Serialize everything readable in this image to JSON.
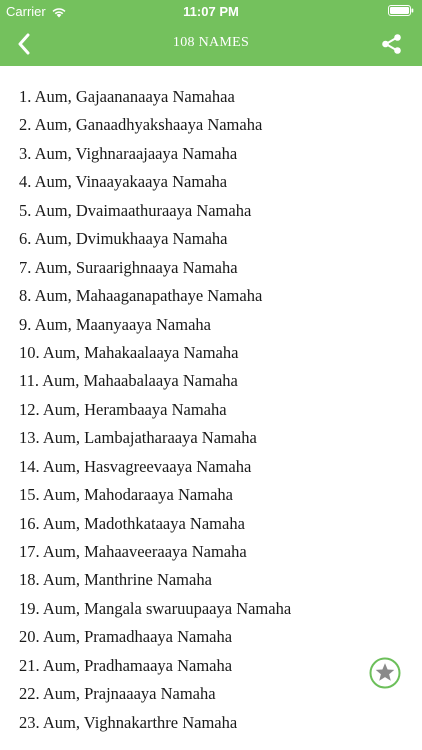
{
  "status_bar": {
    "carrier": "Carrier",
    "time": "11:07 PM",
    "icons": [
      "wifi-icon",
      "battery-icon"
    ]
  },
  "nav": {
    "title": "108 NAMES",
    "back_icon": "chevron-left-icon",
    "share_icon": "share-icon"
  },
  "names": [
    "1. Aum, Gajaananaaya Namahaa",
    "2. Aum, Ganaadhyakshaaya Namaha",
    "3. Aum, Vighnaraajaaya Namaha",
    "4. Aum, Vinaayakaaya Namaha",
    "5. Aum, Dvaimaathuraaya Namaha",
    "6. Aum, Dvimukhaaya Namaha",
    "7. Aum, Suraarighnaaya Namaha",
    "8. Aum, Mahaaganapathaye Namaha",
    "9. Aum, Maanyaaya Namaha",
    "10. Aum, Mahakaalaaya Namaha",
    "11. Aum, Mahaabalaaya Namaha",
    "12. Aum, Herambaaya Namaha",
    "13. Aum, Lambajatharaaya Namaha",
    "14. Aum, Hasvagreevaaya Namaha",
    "15. Aum, Mahodaraaya Namaha",
    "16. Aum, Madothkataaya Namaha",
    "17. Aum, Mahaaveeraaya Namaha",
    "18. Aum, Manthrine Namaha",
    "19. Aum, Mangala swaruupaaya Namaha",
    "20. Aum, Pramadhaaya Namaha",
    "21. Aum, Pradhamaaya Namaha",
    "22. Aum, Prajnaaaya Namaha",
    "23. Aum, Vighnakarthre Namaha"
  ],
  "fab": {
    "icon": "star-icon"
  },
  "colors": {
    "accent": "#74c15d",
    "text": "#1a1a1a",
    "fab_ring": "#6cbf5a",
    "fab_star": "#8a8a8a"
  }
}
